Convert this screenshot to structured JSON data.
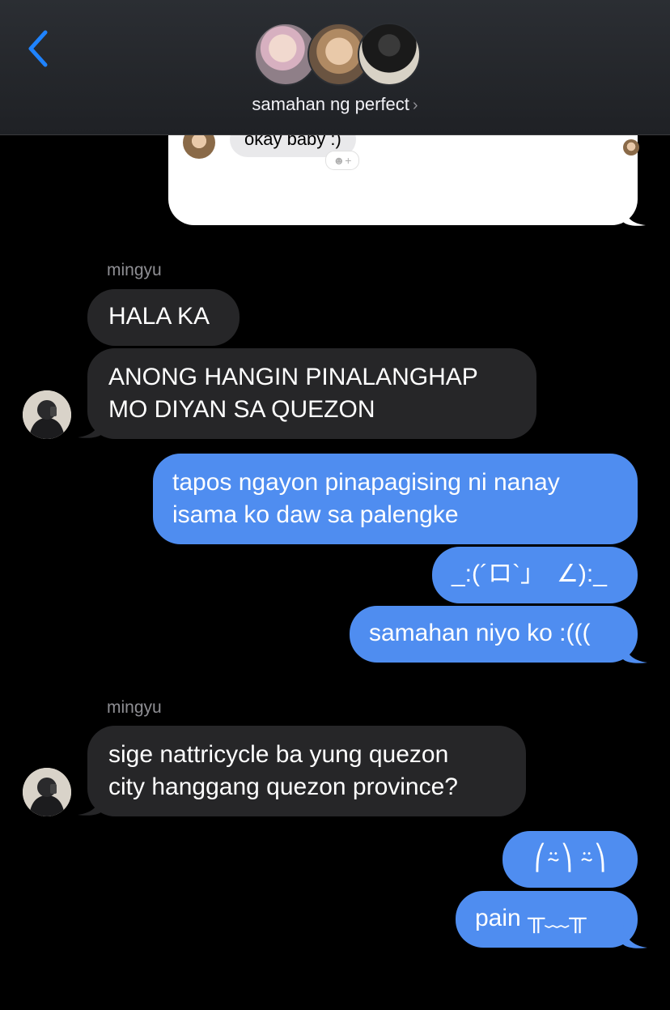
{
  "header": {
    "group_title": "samahan ng perfect",
    "chevron": "›"
  },
  "quote": {
    "text": "okay baby :)",
    "reaction_icon": "☻+"
  },
  "messages": [
    {
      "sender": "mingyu"
    },
    {
      "text": "HALA KA"
    },
    {
      "text": "ANONG HANGIN PINALANGHAP\nMO DIYAN SA QUEZON"
    },
    {
      "text": "tapos ngayon pinapagising ni nanay\nisama ko daw sa palengke"
    },
    {
      "text": "_:(´ロ`」　∠):_"
    },
    {
      "text": "samahan niyo ko :((("
    },
    {
      "sender": "mingyu"
    },
    {
      "text": "sige nattricycle ba yung quezon\ncity hanggang quezon province?"
    },
    {
      "text": "⎛⍨⎞ ⍨⎞"
    },
    {
      "text": "pain ╥﹏╥"
    }
  ],
  "colors": {
    "sent_bubble": "#4f8df0",
    "received_bubble": "#262628",
    "accent": "#1f83ff"
  }
}
